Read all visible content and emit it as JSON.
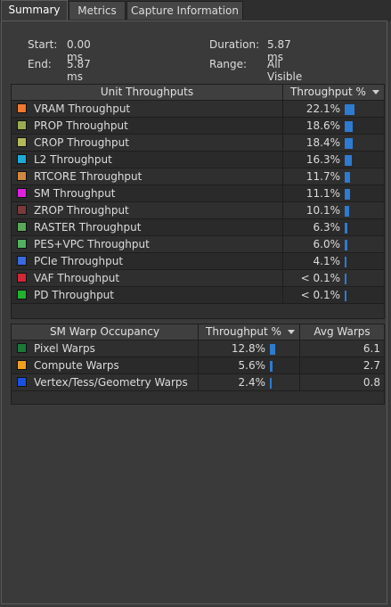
{
  "tabs": [
    {
      "label": "Summary",
      "active": true
    },
    {
      "label": "Metrics",
      "active": false
    },
    {
      "label": "Capture Information",
      "active": false
    }
  ],
  "summary": {
    "start_label": "Start:",
    "start_value": "0.00 ms",
    "end_label": "End:",
    "end_value": "5.87 ms",
    "duration_label": "Duration:",
    "duration_value": "5.87 ms",
    "range_label": "Range:",
    "range_value": "All Visible"
  },
  "unit_table": {
    "col_name": "Unit Throughputs",
    "col_pct": "Throughput %",
    "rows": [
      {
        "name": "VRAM Throughput",
        "pct": "22.1%",
        "value": 22.1,
        "color": "#f07830"
      },
      {
        "name": "PROP Throughput",
        "pct": "18.6%",
        "value": 18.6,
        "color": "#9aaa50"
      },
      {
        "name": "CROP Throughput",
        "pct": "18.4%",
        "value": 18.4,
        "color": "#b5b85a"
      },
      {
        "name": "L2 Throughput",
        "pct": "16.3%",
        "value": 16.3,
        "color": "#1ea8d8"
      },
      {
        "name": "RTCORE Throughput",
        "pct": "11.7%",
        "value": 11.7,
        "color": "#d08840"
      },
      {
        "name": "SM Throughput",
        "pct": "11.1%",
        "value": 11.1,
        "color": "#e020e0"
      },
      {
        "name": "ZROP Throughput",
        "pct": "10.1%",
        "value": 10.1,
        "color": "#7a3a3a"
      },
      {
        "name": "RASTER Throughput",
        "pct": "6.3%",
        "value": 6.3,
        "color": "#58a858"
      },
      {
        "name": "PES+VPC Throughput",
        "pct": "6.0%",
        "value": 6.0,
        "color": "#52b060"
      },
      {
        "name": "PCIe Throughput",
        "pct": "4.1%",
        "value": 4.1,
        "color": "#3a6ae0"
      },
      {
        "name": "VAF Throughput",
        "pct": "< 0.1%",
        "value": 0.05,
        "color": "#d02838"
      },
      {
        "name": "PD Throughput",
        "pct": "< 0.1%",
        "value": 0.05,
        "color": "#22b030"
      }
    ]
  },
  "warp_table": {
    "col_name": "SM Warp Occupancy",
    "col_pct": "Throughput %",
    "col_avg": "Avg Warps",
    "rows": [
      {
        "name": "Pixel Warps",
        "pct": "12.8%",
        "value": 12.8,
        "avg": "6.1",
        "color": "#1a7a3a"
      },
      {
        "name": "Compute Warps",
        "pct": "5.6%",
        "value": 5.6,
        "avg": "2.7",
        "color": "#f0a020"
      },
      {
        "name": "Vertex/Tess/Geometry Warps",
        "pct": "2.4%",
        "value": 2.4,
        "avg": "0.8",
        "color": "#1a50e0"
      }
    ]
  }
}
